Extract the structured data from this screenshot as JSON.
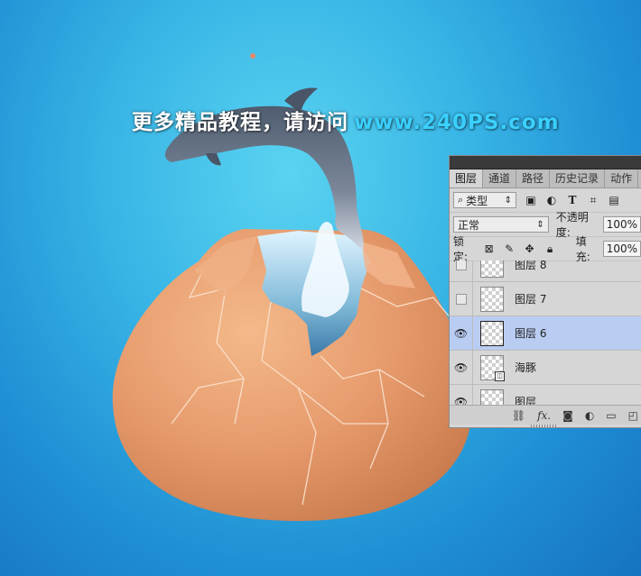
{
  "watermark": {
    "text": "更多精品教程，请访问",
    "url": "www.240PS.com"
  },
  "panel": {
    "tabs": [
      {
        "label": "图层",
        "active": true
      },
      {
        "label": "通道"
      },
      {
        "label": "路径"
      },
      {
        "label": "历史记录"
      },
      {
        "label": "动作"
      }
    ],
    "filter": {
      "label": "类型",
      "icons": [
        "image-filter-icon",
        "adjustment-filter-icon",
        "type-filter-icon",
        "shape-filter-icon",
        "smart-object-filter-icon"
      ]
    },
    "blend_mode": "正常",
    "opacity_label": "不透明度:",
    "opacity_value": "100%",
    "lock_label": "锁定:",
    "fill_label": "填充:",
    "fill_value": "100%",
    "layers": [
      {
        "name": "图层 8",
        "visible": false
      },
      {
        "name": "图层 7",
        "visible": false
      },
      {
        "name": "图层 6",
        "visible": true,
        "selected": true
      },
      {
        "name": "海豚",
        "visible": true,
        "smart": true
      },
      {
        "name": "图层",
        "visible": true
      }
    ],
    "bottom_icons": [
      "link-icon",
      "fx-icon",
      "mask-icon",
      "adjustment-icon",
      "folder-icon",
      "new-layer-icon"
    ],
    "fx_label": "fx."
  },
  "colors": {
    "bg_top": "#5ad3f0",
    "bg_bottom": "#1673c0",
    "egg": "#e69a6c",
    "selected_layer": "#b9ccf2"
  }
}
